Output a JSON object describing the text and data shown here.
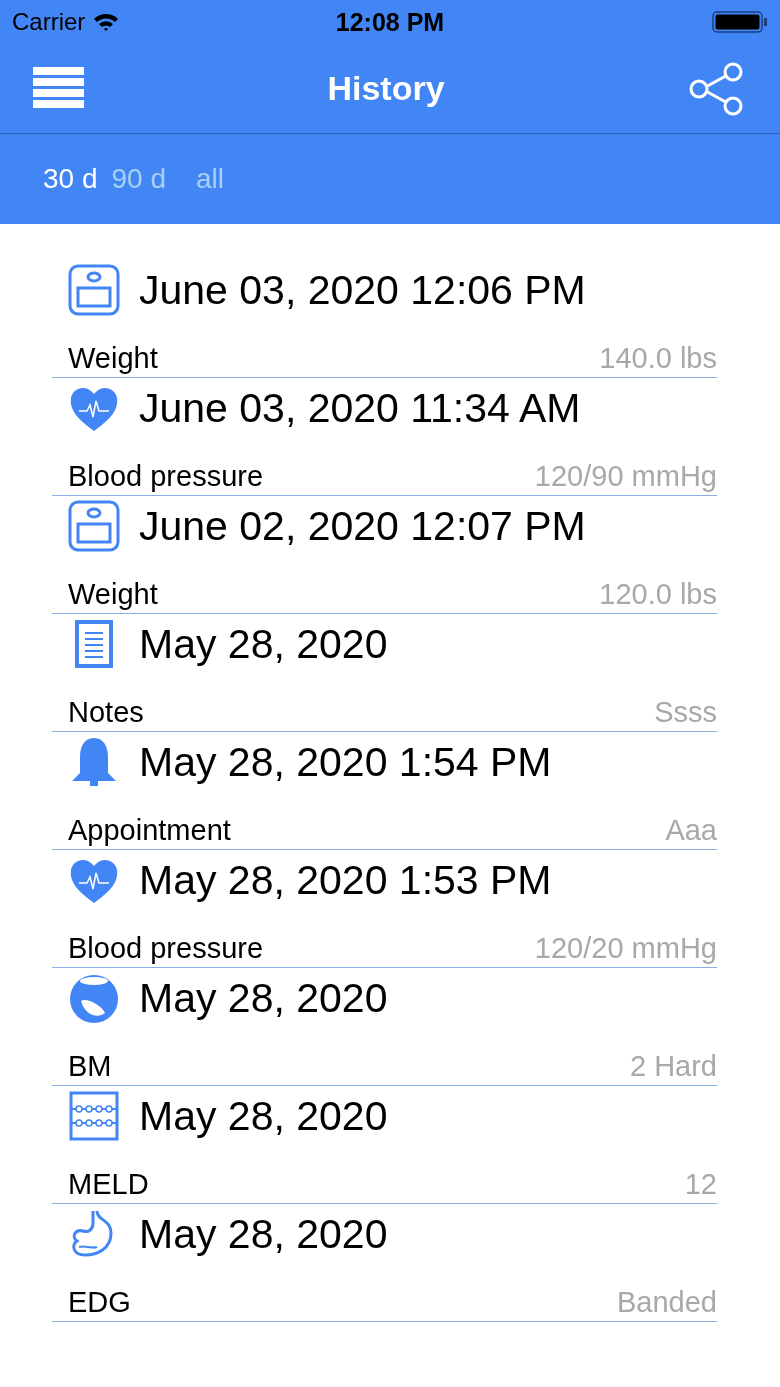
{
  "status_bar": {
    "carrier": "Carrier",
    "time": "12:08 PM"
  },
  "nav": {
    "title": "History"
  },
  "filters": [
    {
      "label": "30 d",
      "selected": true
    },
    {
      "label": "90 d",
      "selected": false
    },
    {
      "label": "all",
      "selected": false
    }
  ],
  "entries": [
    {
      "kind": "weight",
      "date": "June 03, 2020 12:06 PM",
      "label": "Weight",
      "value": "140.0 lbs"
    },
    {
      "kind": "blood_pressure",
      "date": "June 03, 2020 11:34 AM",
      "label": "Blood pressure",
      "value": "120/90 mmHg"
    },
    {
      "kind": "weight",
      "date": "June 02, 2020 12:07 PM",
      "label": "Weight",
      "value": "120.0 lbs"
    },
    {
      "kind": "notes",
      "date": "May 28, 2020",
      "label": "Notes",
      "value": "Ssss"
    },
    {
      "kind": "appointment",
      "date": "May 28, 2020 1:54 PM",
      "label": "Appointment",
      "value": "Aaa"
    },
    {
      "kind": "blood_pressure",
      "date": "May 28, 2020 1:53 PM",
      "label": "Blood pressure",
      "value": "120/20 mmHg"
    },
    {
      "kind": "bm",
      "date": "May 28, 2020",
      "label": "BM",
      "value": "2  Hard"
    },
    {
      "kind": "meld",
      "date": "May 28, 2020",
      "label": "MELD",
      "value": "12"
    },
    {
      "kind": "edg",
      "date": "May 28, 2020",
      "label": "EDG",
      "value": "Banded"
    }
  ]
}
